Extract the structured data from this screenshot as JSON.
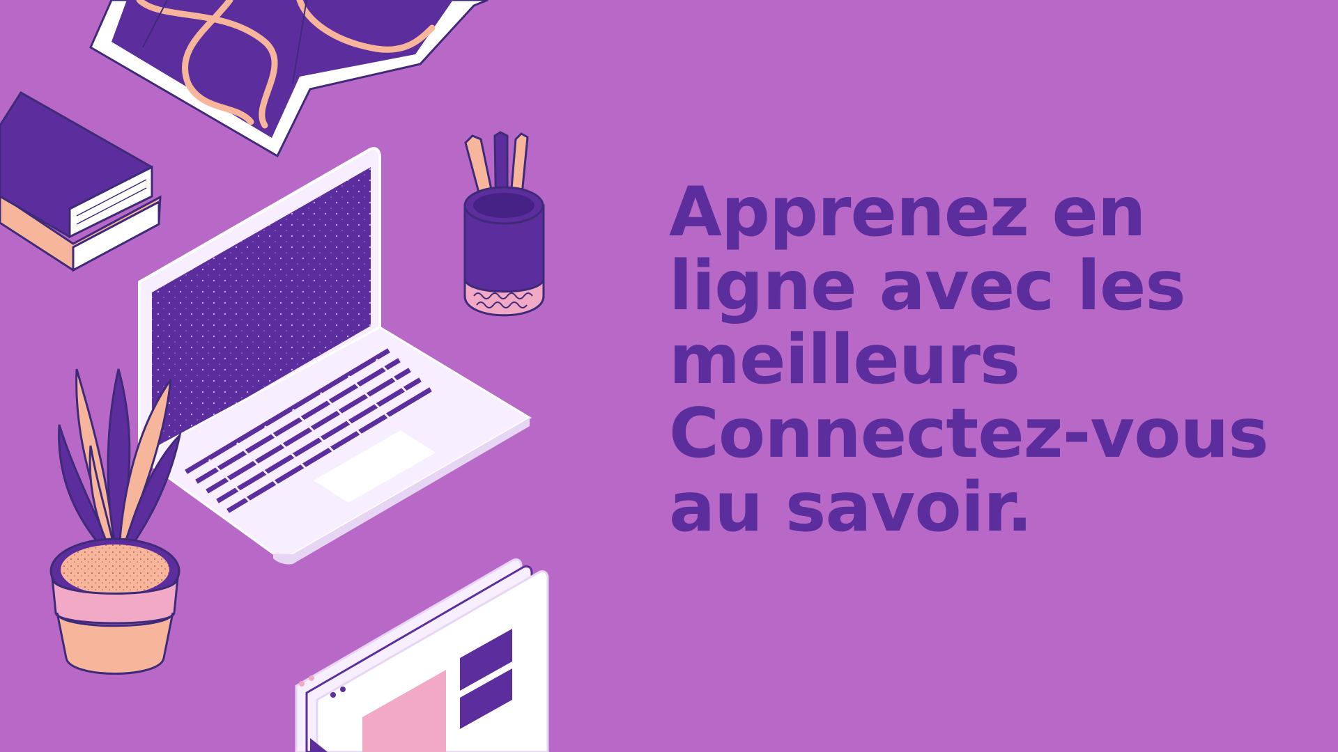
{
  "headline": {
    "lines": [
      "Apprenez en",
      "ligne avec les",
      "meilleurs",
      "Connectez-vous",
      "au savoir."
    ]
  },
  "colors": {
    "background": "#b868c6",
    "primary_purple": "#5c2d9c",
    "peach": "#f7b59c",
    "light_lavender": "#f7efff",
    "pink": "#f2a9c6",
    "outline": "#3f2a7a"
  },
  "illustrations": [
    "map-icon",
    "books-icon",
    "laptop-icon",
    "pencil-cup-icon",
    "potted-plant-icon",
    "browser-windows-icon"
  ]
}
